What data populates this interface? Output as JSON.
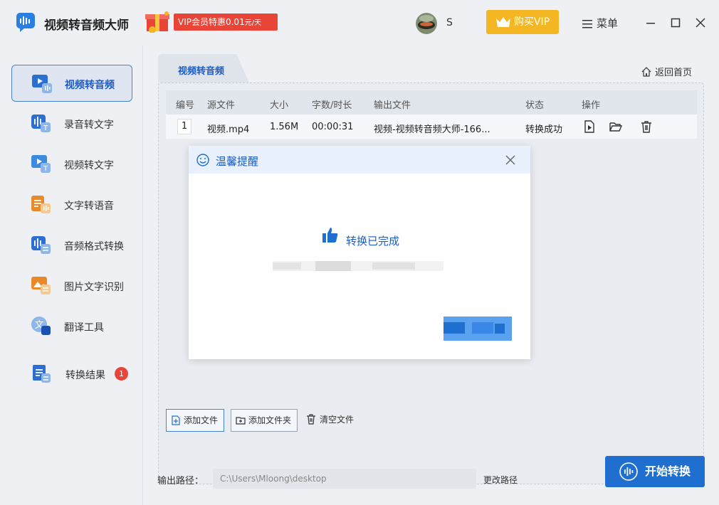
{
  "app": {
    "title": "视频转音频大师",
    "vip_promo": "VIP会员特惠0.01",
    "vip_promo_unit": "元/天",
    "user_name": "S",
    "buy_vip": "购买VIP",
    "menu": "菜单"
  },
  "sidebar": {
    "items": [
      {
        "label": "视频转音频",
        "icon": "video-to-audio-icon",
        "active": true
      },
      {
        "label": "录音转文字",
        "icon": "recording-to-text-icon"
      },
      {
        "label": "视频转文字",
        "icon": "video-to-text-icon"
      },
      {
        "label": "文字转语音",
        "icon": "text-to-speech-icon"
      },
      {
        "label": "音频格式转换",
        "icon": "audio-format-icon"
      },
      {
        "label": "图片文字识别",
        "icon": "image-ocr-icon"
      },
      {
        "label": "翻译工具",
        "icon": "translate-icon"
      },
      {
        "label": "转换结果",
        "icon": "results-icon",
        "badge": "1"
      }
    ]
  },
  "main": {
    "tab": "视频转音频",
    "home_link": "返回首页",
    "table": {
      "headers": [
        "编号",
        "源文件",
        "大小",
        "字数/时长",
        "输出文件",
        "状态",
        "操作"
      ],
      "rows": [
        {
          "num": "1",
          "source": "视频.mp4",
          "size": "1.56M",
          "duration": "00:00:31",
          "output": "视频-视频转音频大师-166...",
          "status": "转换成功"
        }
      ]
    },
    "buttons": {
      "add_file": "添加文件",
      "add_folder": "添加文件夹",
      "clear_files": "清空文件"
    },
    "output": {
      "label": "输出路径：",
      "path": "C:\\Users\\Mloong\\desktop",
      "change": "更改路径"
    },
    "start": "开始转换"
  },
  "dialog": {
    "title": "温馨提醒",
    "message": "转换已完成"
  },
  "colors": {
    "accent": "#1f6fd1",
    "vip": "#f5b623",
    "promo": "#e94438",
    "badge": "#e94438"
  }
}
